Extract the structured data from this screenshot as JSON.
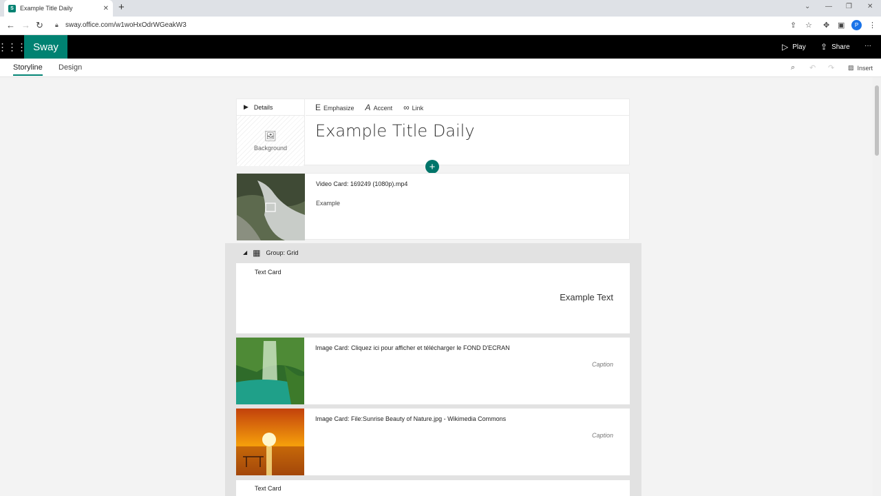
{
  "browser": {
    "tab_title": "Example Title Daily",
    "tab_favicon": "S",
    "url": "sway.office.com/w1woHxOdrWGeakW3",
    "profile_initial": "P"
  },
  "app": {
    "brand": "Sway",
    "play_label": "Play",
    "share_label": "Share",
    "more_label": "···",
    "accent_color": "#008272"
  },
  "ribbon": {
    "tabs": [
      "Storyline",
      "Design"
    ],
    "insert_label": "Insert"
  },
  "title_card": {
    "details_label": "Details",
    "background_label": "Background",
    "toolbar": [
      "Emphasize",
      "Accent",
      "Link"
    ],
    "title": "Example Title Daily"
  },
  "video_card": {
    "title": "Video Card: 169249 (1080p).mp4",
    "text": "Example"
  },
  "group": {
    "label": "Group: Grid"
  },
  "text_card": {
    "label": "Text Card",
    "text": "Example Text"
  },
  "image_cards": [
    {
      "title": "Image Card: Cliquez ici pour afficher et télécharger le FOND D'ECRAN",
      "caption": "Caption"
    },
    {
      "title": "Image Card: File:Sunrise Beauty of Nature.jpg - Wikimedia Commons",
      "caption": "Caption"
    }
  ],
  "text_card_2": {
    "label": "Text Card"
  }
}
